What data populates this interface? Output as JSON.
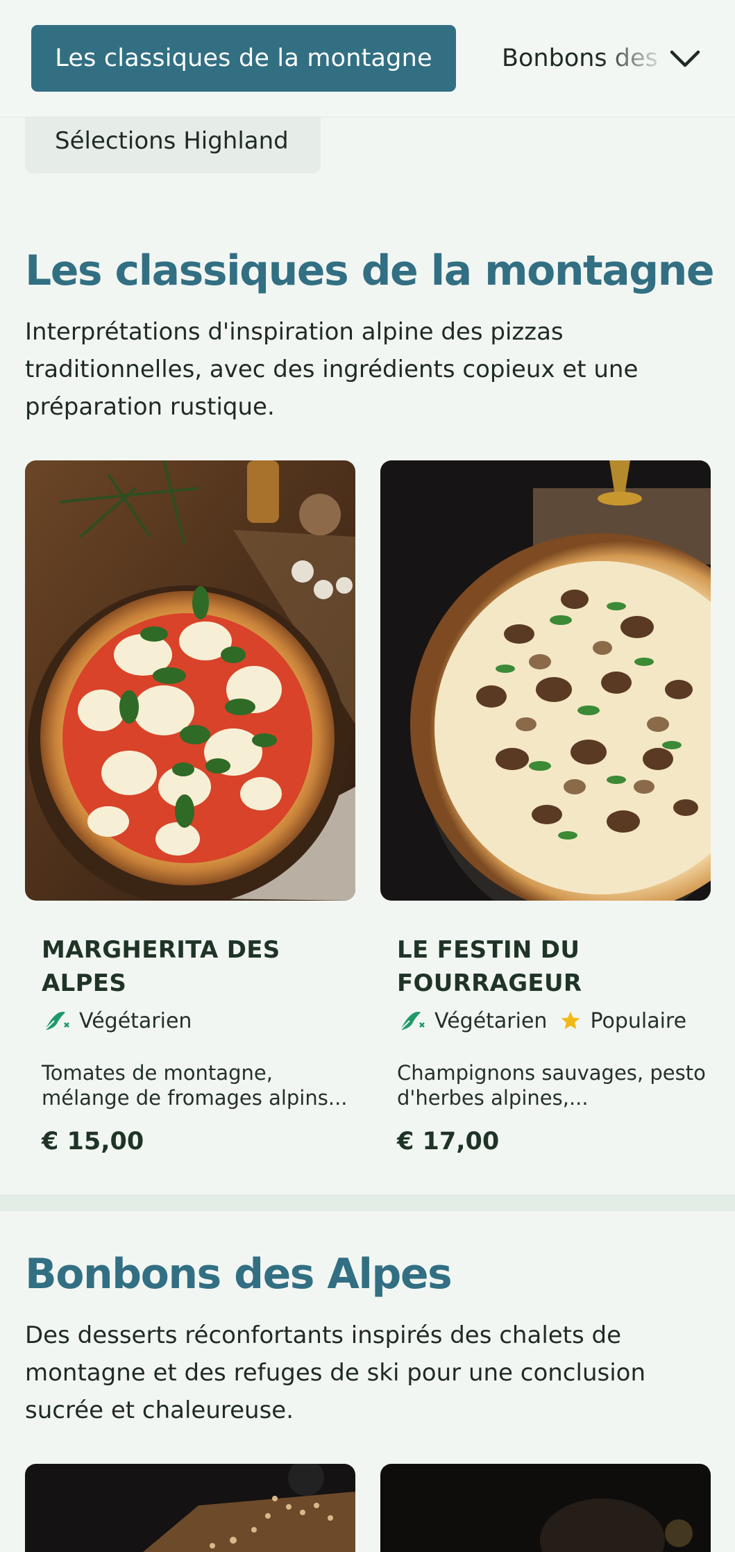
{
  "nav": {
    "active_tab": "Les classiques de la montagne",
    "next_tab": "Bonbons des Alpes",
    "prev_chip": "Sélections Highland"
  },
  "sections": [
    {
      "title": "Les classiques de la montagne",
      "description": "Interprétations d'inspiration alpine des pizzas traditionnelles, avec des ingrédients copieux et une préparation rustique.",
      "items": [
        {
          "name": "MARGHERITA DES ALPES",
          "tags": [
            {
              "label": "Végétarien",
              "icon": "vegetarian-icon"
            }
          ],
          "description": "Tomates de montagne, mélange de fromages alpins...",
          "price": "€ 15,00"
        },
        {
          "name": "LE FESTIN DU FOURRAGEUR",
          "tags": [
            {
              "label": "Végétarien",
              "icon": "vegetarian-icon"
            },
            {
              "label": "Populaire",
              "icon": "star-icon"
            }
          ],
          "description": "Champignons sauvages, pesto d'herbes alpines,...",
          "price": "€ 17,00"
        }
      ]
    },
    {
      "title": "Bonbons des Alpes",
      "description": "Des desserts réconfortants inspirés des chalets de montagne et des refuges de ski pour une conclusion sucrée et chaleureuse."
    }
  ],
  "colors": {
    "accent": "#326f83",
    "background": "#f2f6f2",
    "vegetarian": "#1e9a6a",
    "star": "#f2b817"
  }
}
